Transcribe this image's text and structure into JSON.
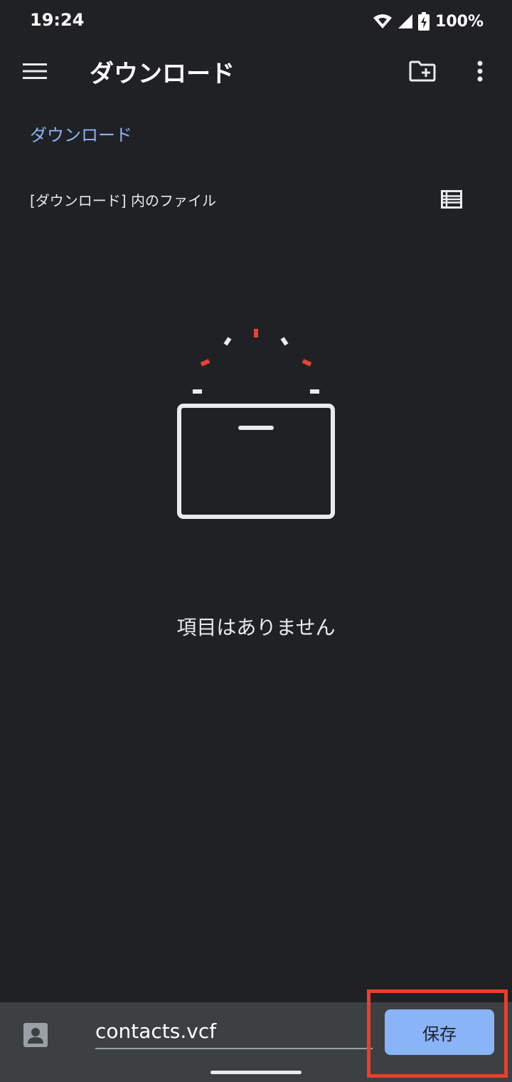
{
  "status_bar": {
    "time": "19:24",
    "battery": "100%",
    "icons": [
      "wifi-icon",
      "cell-signal-icon",
      "battery-charging-icon"
    ]
  },
  "app_bar": {
    "title": "ダウンロード",
    "icons": [
      "menu-icon",
      "new-folder-icon",
      "more-vert-icon"
    ]
  },
  "breadcrumb": {
    "label": "ダウンロード"
  },
  "section": {
    "header": "[ダウンロード] 内のファイル",
    "view_icon": "list-view-icon"
  },
  "empty_state": {
    "message": "項目はありません"
  },
  "bottom_bar": {
    "file_icon": "contact-icon",
    "filename": "contacts.vcf",
    "save_label": "保存"
  },
  "colors": {
    "background": "#202124",
    "accent": "#8ab4f8",
    "bottom_bar": "#3c4043",
    "highlight": "#e8402a",
    "illustration_red": "#ea4335"
  }
}
